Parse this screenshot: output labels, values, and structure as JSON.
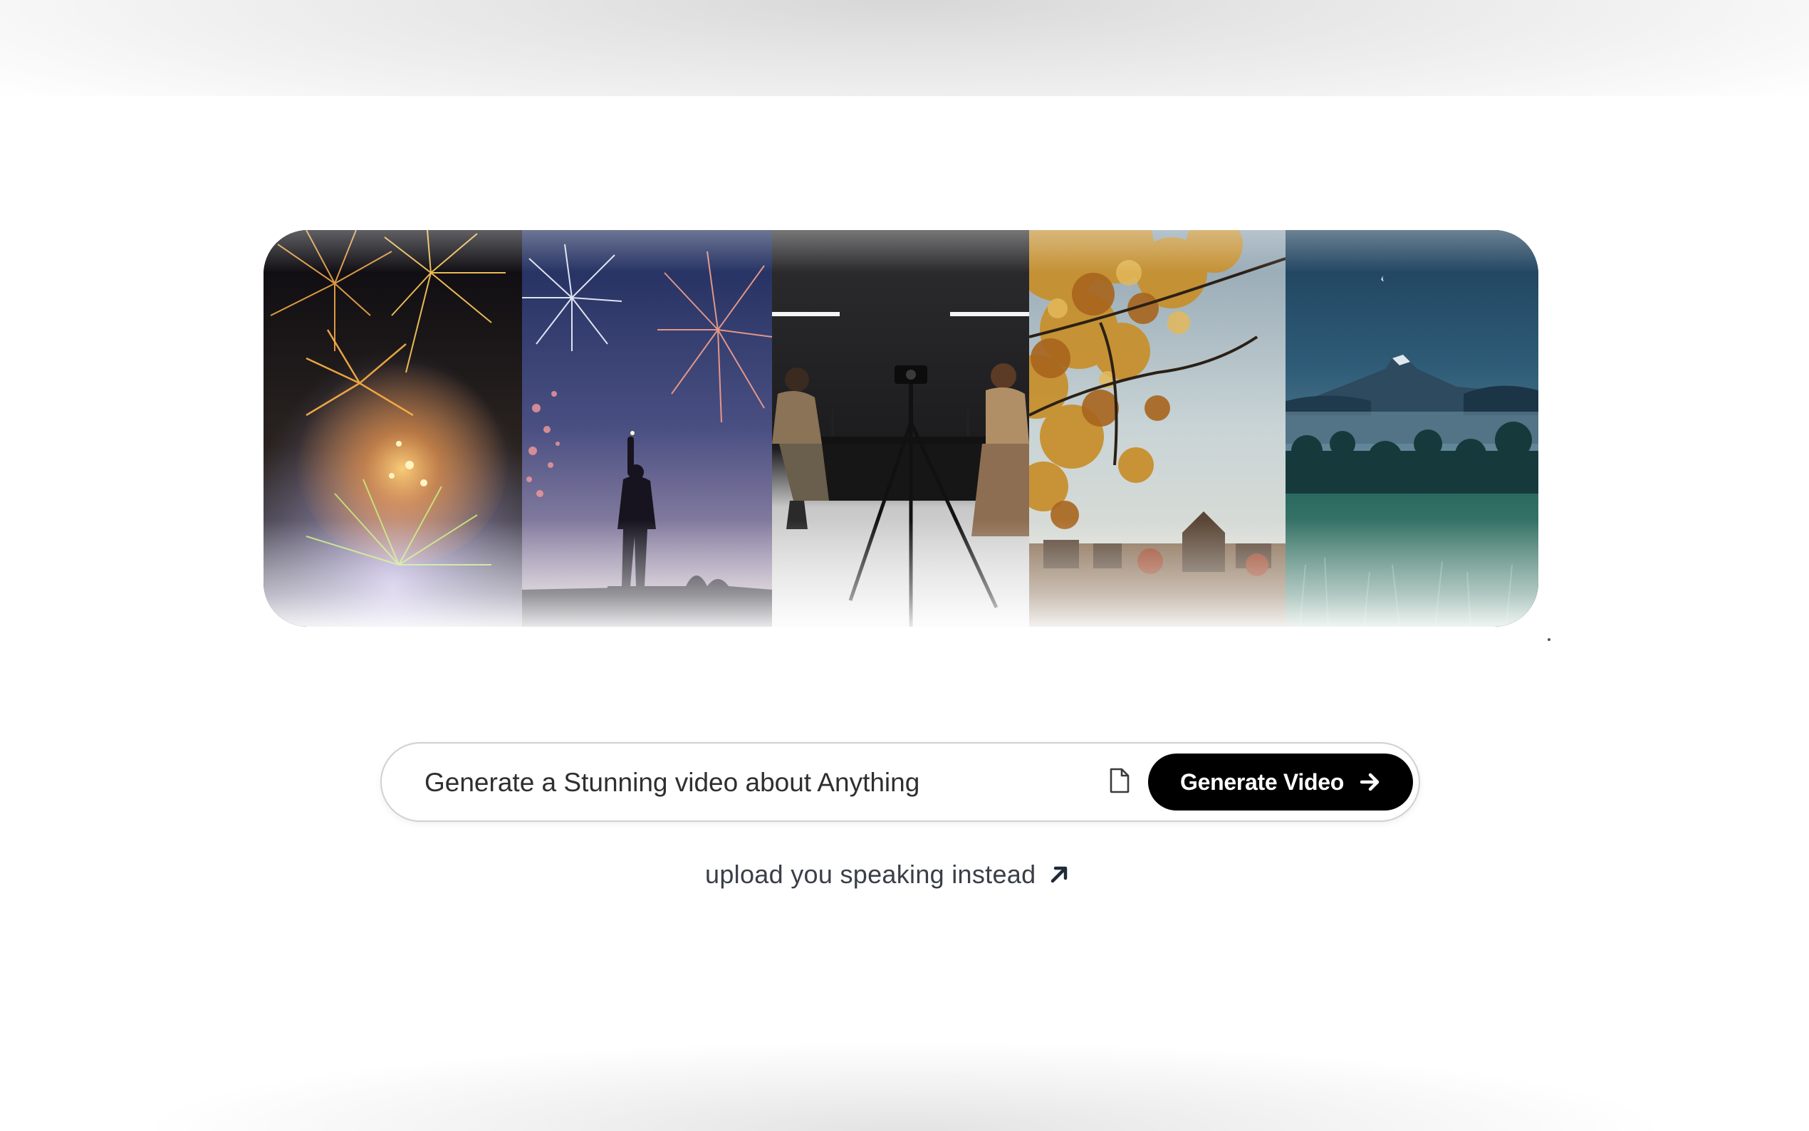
{
  "banner": {
    "panels": [
      {
        "name": "fireworks-panel",
        "scene": "fireworks"
      },
      {
        "name": "fireworks-silhouette-panel",
        "scene": "fireworks-with-person-silhouette"
      },
      {
        "name": "podcast-studio-panel",
        "scene": "two-people-at-table-with-camera"
      },
      {
        "name": "autumn-tree-panel",
        "scene": "autumn-tree-and-houses"
      },
      {
        "name": "mountain-night-panel",
        "scene": "mountain-valley-at-night"
      }
    ]
  },
  "prompt": {
    "placeholder": "Generate a Stunning video about Anything",
    "value": "",
    "attach_icon": "file-icon"
  },
  "generate_button": {
    "label": "Generate Video",
    "icon": "arrow-right-icon",
    "background": "#000000",
    "color": "#ffffff"
  },
  "upload_link": {
    "label": "upload you speaking instead",
    "icon": "arrow-up-right-icon",
    "color": "#3a3f47"
  }
}
